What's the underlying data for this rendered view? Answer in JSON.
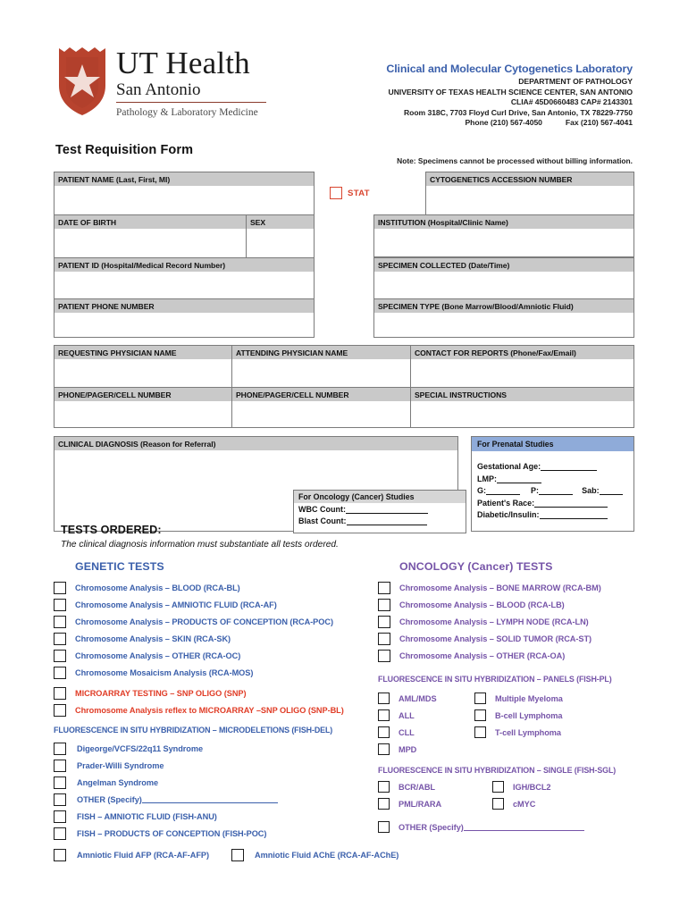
{
  "header": {
    "logo": {
      "ut_health": "UT Health",
      "san_antonio": "San Antonio",
      "dept": "Pathology & Laboratory Medicine"
    },
    "form_title": "Test Requisition Form",
    "lab_title": "Clinical and Molecular Cytogenetics Laboratory",
    "lab_lines": [
      "DEPARTMENT OF PATHOLOGY",
      "UNIVERSITY OF TEXAS HEALTH SCIENCE CENTER, SAN ANTONIO",
      "CLIA# 45D0660483   CAP# 2143301",
      "Room 318C, 7703 Floyd Curl Drive, San Antonio, TX 78229-7750"
    ],
    "phone": "Phone (210) 567-4050",
    "fax": "Fax  (210) 567-4041",
    "billing_note": "Note: Specimens cannot be processed without billing information."
  },
  "stat": {
    "label": "STAT"
  },
  "fields": {
    "patient_name": "PATIENT NAME (Last, First, MI)",
    "date_of_birth": "DATE OF BIRTH",
    "sex": "SEX",
    "patient_id": "PATIENT ID (Hospital/Medical Record Number)",
    "patient_phone": "PATIENT PHONE NUMBER",
    "accession": "CYTOGENETICS ACCESSION NUMBER",
    "institution": "INSTITUTION (Hospital/Clinic Name)",
    "specimen_collected": "SPECIMEN COLLECTED (Date/Time)",
    "specimen_type": "SPECIMEN TYPE (Bone Marrow/Blood/Amniotic Fluid)",
    "requesting_physician": "REQUESTING PHYSICIAN NAME",
    "attending_physician": "ATTENDING PHYSICIAN NAME",
    "contact_reports": "CONTACT FOR REPORTS (Phone/Fax/Email)",
    "phone_pager_1": "PHONE/PAGER/CELL NUMBER",
    "phone_pager_2": "PHONE/PAGER/CELL NUMBER",
    "special_instructions": "SPECIAL INSTRUCTIONS",
    "clinical_diagnosis": "CLINICAL DIAGNOSIS (Reason for Referral)"
  },
  "prenatal": {
    "title": "For Prenatal Studies",
    "gestational_age": "Gestational Age:",
    "lmp": "LMP:",
    "g": "G:",
    "p": "P:",
    "sab": "Sab:",
    "race": "Patient's Race:",
    "diabetic": "Diabetic/Insulin:"
  },
  "oncology_studies": {
    "title": "For Oncology (Cancer) Studies",
    "wbc": "WBC Count:",
    "blast": "Blast Count:"
  },
  "tests": {
    "heading": "TESTS ORDERED:",
    "subheading": "The clinical diagnosis information must substantiate all tests ordered.",
    "genetic_heading": "GENETIC TESTS",
    "oncology_heading": "ONCOLOGY (Cancer) TESTS",
    "genetic_items": [
      "Chromosome Analysis – BLOOD (RCA-BL)",
      "Chromosome Analysis – AMNIOTIC FLUID (RCA-AF)",
      "Chromosome Analysis – PRODUCTS OF CONCEPTION (RCA-POC)",
      "Chromosome Analysis – SKIN (RCA-SK)",
      "Chromosome Analysis – OTHER (RCA-OC)",
      "Chromosome Mosaicism Analysis (RCA-MOS)"
    ],
    "microarray_items": [
      "MICROARRAY TESTING – SNP OLIGO (SNP)",
      "Chromosome Analysis reflex to MICROARRAY –SNP OLIGO (SNP-BL)"
    ],
    "fish_del_heading": "FLUORESCENCE IN SITU HYBRIDIZATION – MICRODELETIONS (FISH-DEL)",
    "fish_del_items": [
      "Digeorge/VCFS/22q11 Syndrome",
      "Prader-Willi Syndrome",
      "Angelman Syndrome",
      "OTHER (Specify)",
      "FISH – AMNIOTIC FLUID (FISH-ANU)",
      "FISH – PRODUCTS OF CONCEPTION (FISH-POC)"
    ],
    "amniotic_afp": "Amniotic Fluid AFP (RCA-AF-AFP)",
    "amniotic_ache": "Amniotic Fluid AChE (RCA-AF-AChE)",
    "oncology_items": [
      "Chromosome Analysis – BONE MARROW (RCA-BM)",
      "Chromosome Analysis – BLOOD (RCA-LB)",
      "Chromosome Analysis – LYMPH NODE (RCA-LN)",
      "Chromosome Analysis – SOLID TUMOR (RCA-ST)",
      "Chromosome Analysis – OTHER (RCA-OA)"
    ],
    "fish_pl_heading": "FLUORESCENCE IN SITU HYBRIDIZATION – PANELS (FISH-PL)",
    "fish_pl_left": [
      "AML/MDS",
      "ALL",
      "CLL",
      "MPD"
    ],
    "fish_pl_right": [
      "Multiple Myeloma",
      "B-cell Lymphoma",
      "T-cell Lymphoma"
    ],
    "fish_sgl_heading": "FLUORESCENCE IN SITU HYBRIDIZATION – SINGLE (FISH-SGL)",
    "fish_sgl_left": [
      "BCR/ABL",
      "PML/RARA"
    ],
    "fish_sgl_right": [
      "IGH/BCL2",
      "cMYC"
    ],
    "fish_sgl_other": "OTHER (Specify)"
  },
  "colors": {
    "genetic_blue": "#3a5fab",
    "oncology_purple": "#7654a8",
    "alert_red": "#e03c26",
    "stat_red": "#d9452f",
    "field_gray": "#c9c9c9",
    "prenatal_blue": "#8fabd9"
  }
}
